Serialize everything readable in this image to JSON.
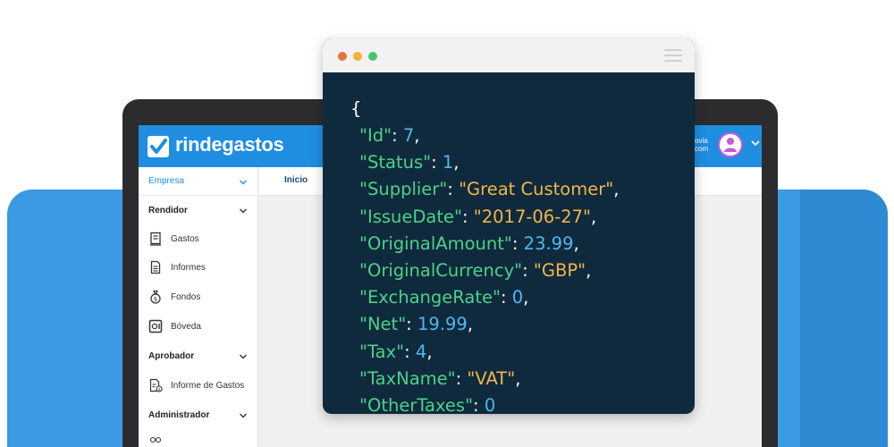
{
  "app": {
    "brand": "rindegastos",
    "user_line1": "ovia",
    "user_line2": "com"
  },
  "sidebar": {
    "empresa_label": "Empresa",
    "sections": [
      {
        "title": "Rendidor",
        "items": [
          {
            "label": "Gastos",
            "icon": "receipt-icon"
          },
          {
            "label": "Informes",
            "icon": "document-icon"
          },
          {
            "label": "Fondos",
            "icon": "money-bag-icon"
          },
          {
            "label": "Bóveda",
            "icon": "vault-icon"
          }
        ]
      },
      {
        "title": "Aprobador",
        "items": [
          {
            "label": "Informe de Gastos",
            "icon": "report-approve-icon"
          }
        ]
      },
      {
        "title": "Administrador",
        "items": []
      }
    ]
  },
  "tabs": {
    "inicio": "Inicio"
  },
  "code": {
    "open_brace": "{",
    "lines": [
      {
        "key": "\"Id\"",
        "value": "7",
        "type": "number"
      },
      {
        "key": "\"Status\"",
        "value": "1",
        "type": "number"
      },
      {
        "key": "\"Supplier\"",
        "value": "\"Great Customer\"",
        "type": "string"
      },
      {
        "key": "\"IssueDate\"",
        "value": "\"2017-06-27\"",
        "type": "string"
      },
      {
        "key": "\"OriginalAmount\"",
        "value": "23.99",
        "type": "number"
      },
      {
        "key": "\"OriginalCurrency\"",
        "value": "\"GBP\"",
        "type": "string"
      },
      {
        "key": "\"ExchangeRate\"",
        "value": "0",
        "type": "number"
      },
      {
        "key": "\"Net\"",
        "value": "19.99",
        "type": "number"
      },
      {
        "key": "\"Tax\"",
        "value": "4",
        "type": "number"
      },
      {
        "key": "\"TaxName\"",
        "value": "\"VAT\"",
        "type": "string"
      },
      {
        "key": "\"OtherTaxes\"",
        "value": "0",
        "type": "number"
      }
    ]
  },
  "colors": {
    "brand_blue": "#1f8ee0",
    "band_blue": "#3a9ae4",
    "code_bg": "#0f2a3d",
    "json_key": "#4ed08a",
    "json_number": "#4db7f1",
    "json_string": "#f0b54a",
    "dot_red": "#e2763a",
    "dot_yellow": "#f2b233",
    "dot_green": "#4cc56a"
  }
}
